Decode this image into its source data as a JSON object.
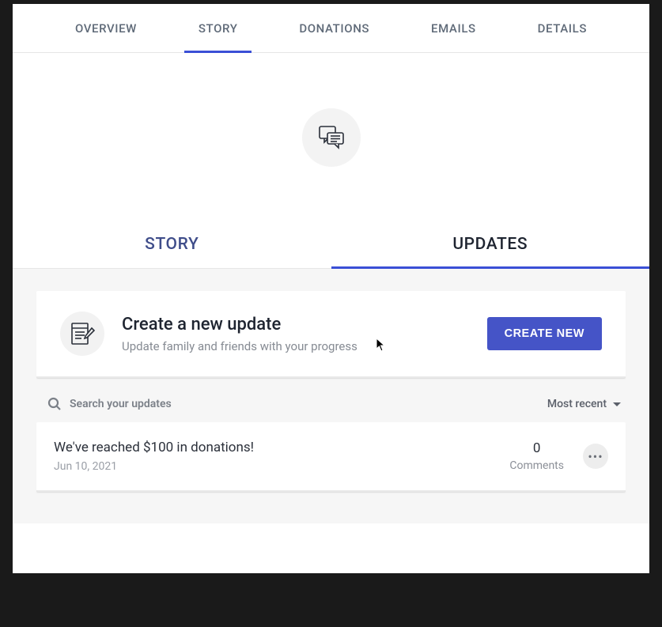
{
  "topTabs": {
    "overview": "OVERVIEW",
    "story": "STORY",
    "donations": "DONATIONS",
    "emails": "EMAILS",
    "details": "DETAILS"
  },
  "subTabs": {
    "story": "STORY",
    "updates": "UPDATES"
  },
  "create": {
    "title": "Create a new update",
    "subtitle": "Update family and friends with your progress",
    "button": "CREATE NEW"
  },
  "search": {
    "placeholder": "Search your updates",
    "sort": "Most recent"
  },
  "updates": [
    {
      "title": "We've reached $100 in donations!",
      "date": "Jun 10, 2021",
      "commentsCount": "0",
      "commentsLabel": "Comments"
    }
  ]
}
